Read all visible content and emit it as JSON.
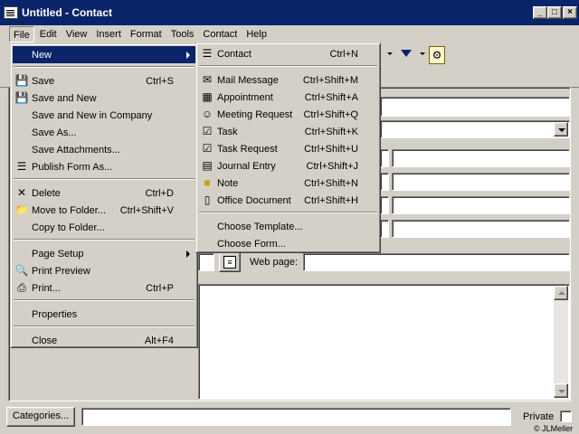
{
  "window": {
    "title": "Untitled - Contact"
  },
  "menubar": [
    "File",
    "Edit",
    "View",
    "Insert",
    "Format",
    "Tools",
    "Contact",
    "Help"
  ],
  "file_menu": {
    "new_label": "New",
    "items": [
      {
        "label": "Save",
        "shortcut": "Ctrl+S",
        "icon": "save-icon"
      },
      {
        "label": "Save and New",
        "shortcut": "",
        "icon": "save-new-icon"
      },
      {
        "label": "Save and New in Company",
        "shortcut": "",
        "icon": ""
      },
      {
        "label": "Save As...",
        "shortcut": "",
        "icon": ""
      },
      {
        "label": "Save Attachments...",
        "shortcut": "",
        "icon": ""
      },
      {
        "label": "Publish Form As...",
        "shortcut": "",
        "icon": "publish-form-icon"
      },
      {
        "label": "Delete",
        "shortcut": "Ctrl+D",
        "icon": "delete-icon"
      },
      {
        "label": "Move to Folder...",
        "shortcut": "Ctrl+Shift+V",
        "icon": "move-folder-icon"
      },
      {
        "label": "Copy to Folder...",
        "shortcut": "",
        "icon": ""
      },
      {
        "label": "Page Setup",
        "shortcut": "",
        "icon": ""
      },
      {
        "label": "Print Preview",
        "shortcut": "",
        "icon": "print-preview-icon"
      },
      {
        "label": "Print...",
        "shortcut": "Ctrl+P",
        "icon": "print-icon"
      },
      {
        "label": "Properties",
        "shortcut": "",
        "icon": ""
      },
      {
        "label": "Close",
        "shortcut": "Alt+F4",
        "icon": ""
      }
    ]
  },
  "new_submenu": {
    "items": [
      {
        "label": "Contact",
        "shortcut": "Ctrl+N"
      },
      {
        "label": "Mail Message",
        "shortcut": "Ctrl+Shift+M"
      },
      {
        "label": "Appointment",
        "shortcut": "Ctrl+Shift+A"
      },
      {
        "label": "Meeting Request",
        "shortcut": "Ctrl+Shift+Q"
      },
      {
        "label": "Task",
        "shortcut": "Ctrl+Shift+K"
      },
      {
        "label": "Task Request",
        "shortcut": "Ctrl+Shift+U"
      },
      {
        "label": "Journal Entry",
        "shortcut": "Ctrl+Shift+J"
      },
      {
        "label": "Note",
        "shortcut": "Ctrl+Shift+N"
      },
      {
        "label": "Office Document",
        "shortcut": "Ctrl+Shift+H"
      },
      {
        "label": "Choose Template...",
        "shortcut": ""
      },
      {
        "label": "Choose Form...",
        "shortcut": ""
      }
    ]
  },
  "form": {
    "web_page_label": "Web page:",
    "categories_button": "Categories...",
    "private_label": "Private",
    "credit": "© JLMeller"
  }
}
